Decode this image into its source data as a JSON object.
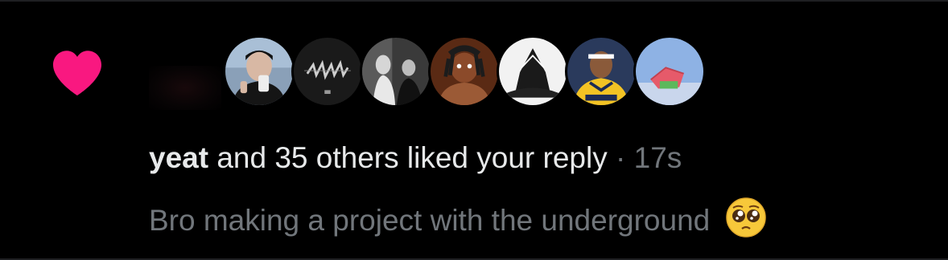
{
  "notification": {
    "icon": "heart-icon",
    "heart_color": "#f91880",
    "avatar_count_shown": 7,
    "avatars": [
      {
        "name": "avatar-1"
      },
      {
        "name": "avatar-2"
      },
      {
        "name": "avatar-3"
      },
      {
        "name": "avatar-4"
      },
      {
        "name": "avatar-5"
      },
      {
        "name": "avatar-6"
      },
      {
        "name": "avatar-7"
      }
    ],
    "username": "yeat",
    "action_text": " and 35 others liked your reply",
    "separator": " · ",
    "timestamp": "17s",
    "reply_text": "Bro making a project with the underground",
    "reply_emoji": "pleading-face-emoji"
  }
}
